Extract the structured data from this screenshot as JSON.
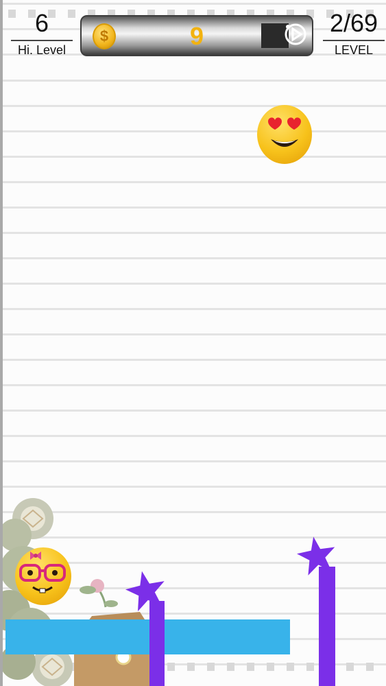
{
  "hud": {
    "hi_level_value": "6",
    "hi_level_label": "Hi. Level",
    "coin_count": "9",
    "coin_symbol": "$",
    "level_value": "2/69",
    "level_label": "LEVEL"
  },
  "scene": {
    "target_emoji": "heart-eyes-emoji",
    "player_emoji": "nerd-girl-emoji",
    "platform_color": "#38b3ea",
    "post_color": "#7b2fe8",
    "coin_color": "#f2b20f"
  }
}
